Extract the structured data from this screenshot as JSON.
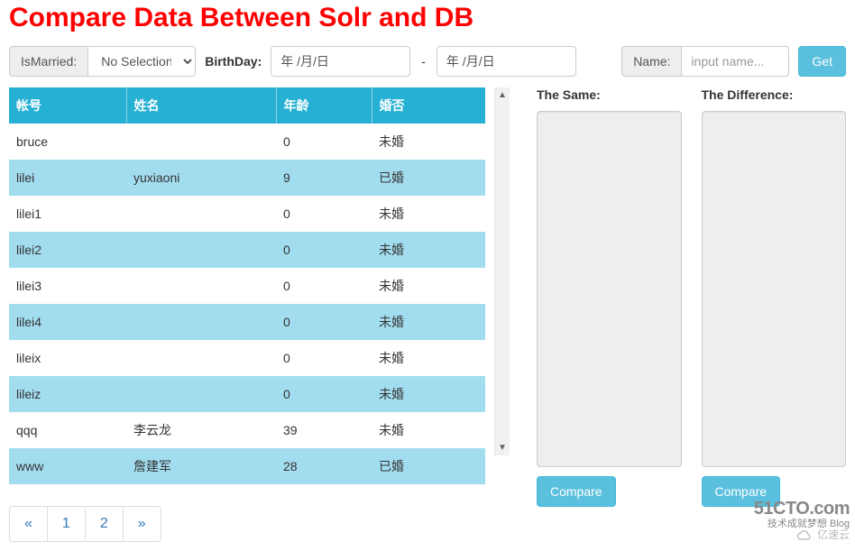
{
  "title": "Compare Data Between Solr and DB",
  "toolbar": {
    "married_label": "IsMarried:",
    "married_select": "No Selection",
    "birthday_label": "BirthDay:",
    "date1": "年 /月/日",
    "date2": "年 /月/日",
    "dash": "-",
    "name_label": "Name:",
    "name_placeholder": "input name...",
    "get_label": "Get"
  },
  "table": {
    "headers": [
      "帐号",
      "姓名",
      "年龄",
      "婚否"
    ],
    "rows": [
      [
        "bruce",
        "",
        "0",
        "未婚"
      ],
      [
        "lilei",
        "yuxiaoni",
        "9",
        "已婚"
      ],
      [
        "lilei1",
        "",
        "0",
        "未婚"
      ],
      [
        "lilei2",
        "",
        "0",
        "未婚"
      ],
      [
        "lilei3",
        "",
        "0",
        "未婚"
      ],
      [
        "lilei4",
        "",
        "0",
        "未婚"
      ],
      [
        "lileix",
        "",
        "0",
        "未婚"
      ],
      [
        "lileiz",
        "",
        "0",
        "未婚"
      ],
      [
        "qqq",
        "李云龙",
        "39",
        "未婚"
      ],
      [
        "www",
        "詹建军",
        "28",
        "已婚"
      ]
    ]
  },
  "pagination": {
    "prev": "«",
    "pages": [
      "1",
      "2"
    ],
    "next": "»"
  },
  "panels": {
    "same_title": "The Same:",
    "diff_title": "The Difference:",
    "compare_label": "Compare",
    "compare_label2": "Compare"
  },
  "watermark": {
    "brand": "51CTO.com",
    "sub": "技术成就梦想   Blog",
    "speed": "亿速云"
  }
}
